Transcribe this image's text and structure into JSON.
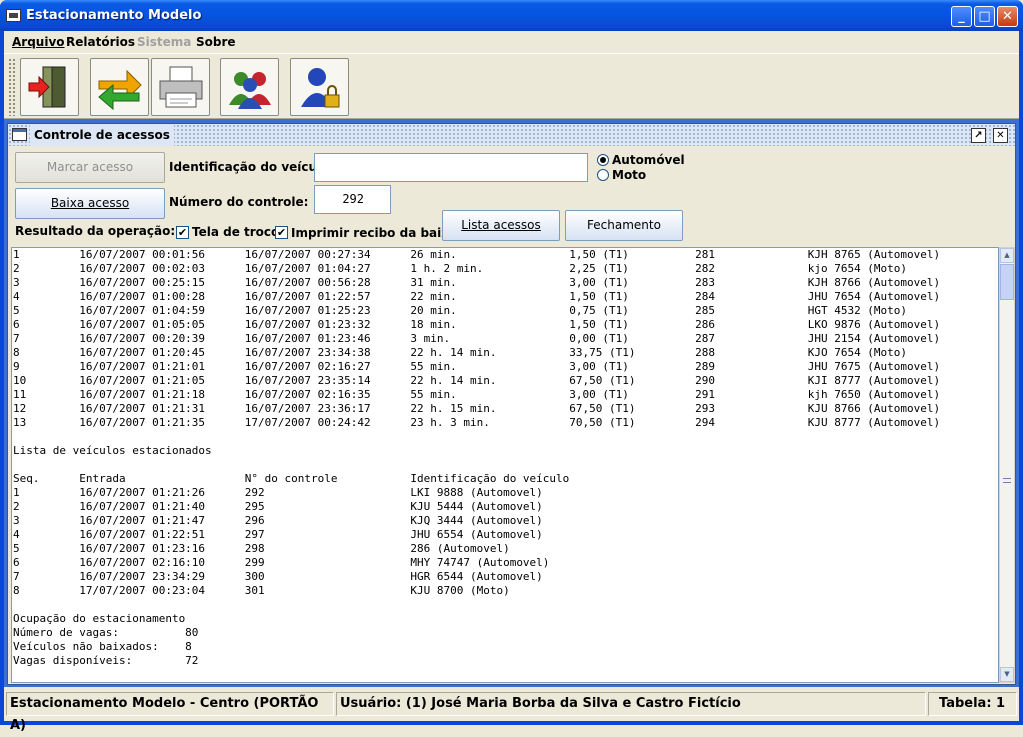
{
  "window": {
    "title": "Estacionamento Modelo"
  },
  "menu": [
    "Arquivo",
    "Relatórios",
    "Sistema",
    "Sobre"
  ],
  "toolbar": [
    "exit-icon",
    "refresh-icon",
    "printer-icon",
    "users-icon",
    "user-lock-icon"
  ],
  "internal_frame": {
    "title": "Controle de acessos"
  },
  "form": {
    "marcar_acesso": "Marcar acesso",
    "baixa_acesso": "Baixa acesso",
    "ident_label": "Identificação do veículo:",
    "ident_value": "",
    "numero_label": "Número do controle:",
    "numero_value": "292",
    "radio_auto": "Automóvel",
    "radio_moto": "Moto",
    "resultado_label": "Resultado da operação:",
    "chk_troco": "Tela de troco",
    "chk_recibo": "Imprimir recibo da baixa",
    "lista_acessos": "Lista acessos",
    "fechamento": "Fechamento"
  },
  "output_lines": [
    "1         16/07/2007 00:01:56      16/07/2007 00:27:34      26 min.                 1,50 (T1)          281              KJH 8765 (Automovel)",
    "2         16/07/2007 00:02:03      16/07/2007 01:04:27      1 h. 2 min.             2,25 (T1)          282              kjo 7654 (Moto)",
    "3         16/07/2007 00:25:15      16/07/2007 00:56:28      31 min.                 3,00 (T1)          283              KJH 8766 (Automovel)",
    "4         16/07/2007 01:00:28      16/07/2007 01:22:57      22 min.                 1,50 (T1)          284              JHU 7654 (Automovel)",
    "5         16/07/2007 01:04:59      16/07/2007 01:25:23      20 min.                 0,75 (T1)          285              HGT 4532 (Moto)",
    "6         16/07/2007 01:05:05      16/07/2007 01:23:32      18 min.                 1,50 (T1)          286              LKO 9876 (Automovel)",
    "7         16/07/2007 00:20:39      16/07/2007 01:23:46      3 min.                  0,00 (T1)          287              JHU 2154 (Automovel)",
    "8         16/07/2007 01:20:45      16/07/2007 23:34:38      22 h. 14 min.           33,75 (T1)         288              KJO 7654 (Moto)",
    "9         16/07/2007 01:21:01      16/07/2007 02:16:27      55 min.                 3,00 (T1)          289              JHU 7675 (Automovel)",
    "10        16/07/2007 01:21:05      16/07/2007 23:35:14      22 h. 14 min.           67,50 (T1)         290              KJI 8777 (Automovel)",
    "11        16/07/2007 01:21:18      16/07/2007 02:16:35      55 min.                 3,00 (T1)          291              kjh 7650 (Automovel)",
    "12        16/07/2007 01:21:31      16/07/2007 23:36:17      22 h. 15 min.           67,50 (T1)         293              KJU 8766 (Automovel)",
    "13        16/07/2007 01:21:35      17/07/2007 00:24:42      23 h. 3 min.            70,50 (T1)         294              KJU 8777 (Automovel)",
    "",
    "Lista de veículos estacionados",
    "",
    "Seq.      Entrada                  N° do controle           Identificação do veículo",
    "1         16/07/2007 01:21:26      292                      LKI 9888 (Automovel)",
    "2         16/07/2007 01:21:40      295                      KJU 5444 (Automovel)",
    "3         16/07/2007 01:21:47      296                      KJQ 3444 (Automovel)",
    "4         16/07/2007 01:22:51      297                      JHU 6554 (Automovel)",
    "5         16/07/2007 01:23:16      298                      286 (Automovel)",
    "6         16/07/2007 02:16:10      299                      MHY 74747 (Automovel)",
    "7         16/07/2007 23:34:29      300                      HGR 6544 (Automovel)",
    "8         17/07/2007 00:23:04      301                      KJU 8700 (Moto)",
    "",
    "Ocupação do estacionamento",
    "Número de vagas:          80",
    "Veículos não baixados:    8",
    "Vagas disponíveis:        72"
  ],
  "status": {
    "left": "Estacionamento Modelo - Centro (PORTÃO A)",
    "middle": "Usuário: (1) José Maria Borba da Silva e Castro Fictício",
    "right": "Tabela: 1"
  }
}
